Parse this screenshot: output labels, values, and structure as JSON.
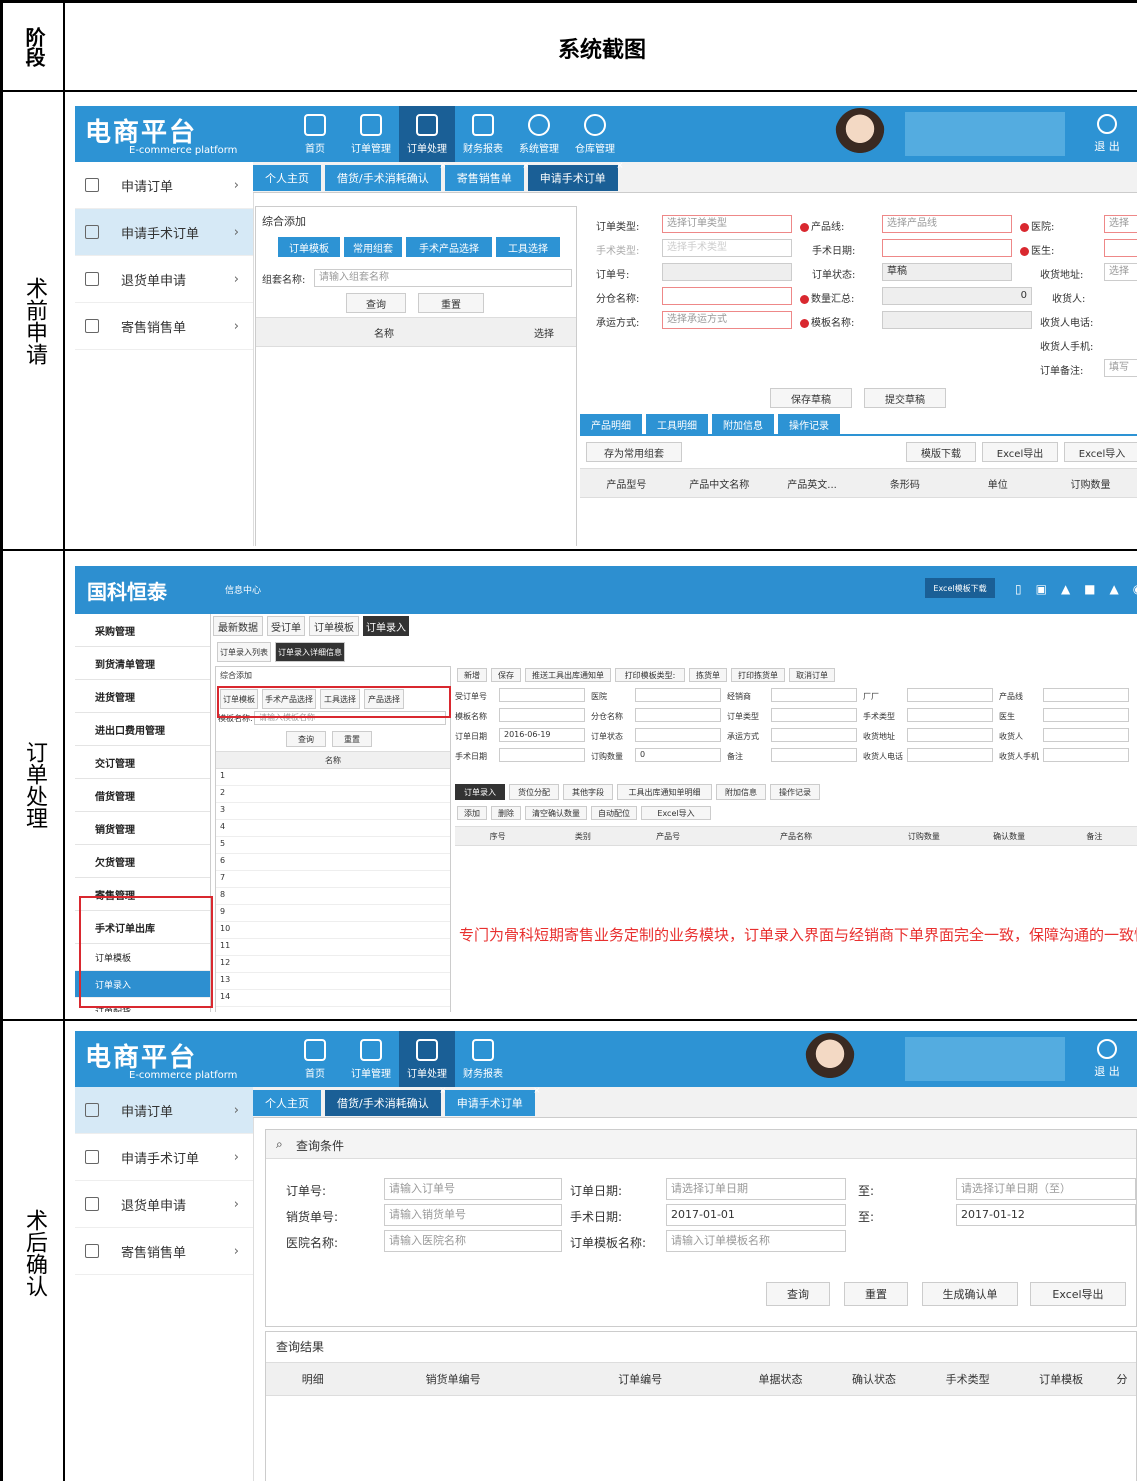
{
  "header": {
    "stage": "阶段",
    "title": "系统截图"
  },
  "rows": [
    {
      "stage": "术前申请"
    },
    {
      "stage": "订单处理"
    },
    {
      "stage": "术后确认"
    }
  ],
  "ec": {
    "logo": "电商平台",
    "logo_sub": "E-commerce platform",
    "nav": [
      "首页",
      "订单管理",
      "订单处理",
      "财务报表",
      "系统管理",
      "仓库管理"
    ],
    "exit": "退 出",
    "side": [
      "申请订单",
      "申请手术订单",
      "退货单申请",
      "寄售销售单"
    ]
  },
  "shot1": {
    "tabs": [
      "个人主页",
      "借货/手术消耗确认",
      "寄售销售单",
      "申请手术订单"
    ],
    "left_title": "综合添加",
    "left_tabs": [
      "订单模板",
      "常用组套",
      "手术产品选择",
      "工具选择"
    ],
    "group_label": "组套名称:",
    "group_placeholder": "请输入组套名称",
    "query": "查询",
    "reset": "重置",
    "col_name": "名称",
    "col_select": "选择",
    "form": {
      "order_type": "订单类型:",
      "order_type_ph": "选择订单类型",
      "product_line": "产品线:",
      "product_line_ph": "选择产品线",
      "hospital": "医院:",
      "hospital_ph": "选择",
      "surgery_type": "手术类型:",
      "surgery_type_ph": "选择手术类型",
      "surgery_date": "手术日期:",
      "doctor": "医生:",
      "order_no": "订单号:",
      "order_status": "订单状态:",
      "order_status_val": "草稿",
      "recv_addr": "收货地址:",
      "recv_addr_ph": "选择",
      "warehouse": "分仓名称:",
      "qty_total": "数量汇总:",
      "qty_total_val": "0",
      "receiver": "收货人:",
      "ship": "承运方式:",
      "ship_ph": "选择承运方式",
      "template": "模板名称:",
      "recv_phone": "收货人电话:",
      "recv_mobile": "收货人手机:",
      "remark": "订单备注:",
      "remark_ph": "填写"
    },
    "save_draft": "保存草稿",
    "submit_draft": "提交草稿",
    "bottom_tabs": [
      "产品明细",
      "工具明细",
      "附加信息",
      "操作记录"
    ],
    "save_common": "存为常用组套",
    "tpl_download": "模版下载",
    "excel_export": "Excel导出",
    "excel_import": "Excel导入",
    "cols": [
      "产品型号",
      "产品中文名称",
      "产品英文...",
      "条形码",
      "单位",
      "订购数量"
    ]
  },
  "shot2": {
    "logo": "国科恒泰",
    "topnav": "信息中心",
    "excel_btn": "Excel模板下载",
    "side": [
      "采购管理",
      "到货清单管理",
      "进货管理",
      "进出口费用管理",
      "交订管理",
      "借货管理",
      "销货管理",
      "欠货管理",
      "寄售管理",
      "手术订单出库"
    ],
    "sub": [
      "订单模板",
      "订单录入",
      "订单配货"
    ],
    "tabs": [
      "最新数据",
      "受订单",
      "订单模板",
      "订单录入"
    ],
    "subtabs": [
      "订单录入列表",
      "订单录入详细信息"
    ],
    "left_title": "综合添加",
    "left_tabs": [
      "订单模板",
      "手术产品选择",
      "工具选择",
      "产品选择"
    ],
    "tpl_label": "模板名称:",
    "tpl_ph": "请输入模板名称",
    "query": "查询",
    "reset": "重置",
    "col_name": "名称",
    "list_rows": [
      "1",
      "2",
      "3",
      "4",
      "5",
      "6",
      "7",
      "8",
      "9",
      "10",
      "11",
      "12",
      "13",
      "14"
    ],
    "toolbar": [
      "新增",
      "保存",
      "推送工具出库通知单",
      "打印模板类型:",
      "拣货单",
      "打印拣货单",
      "取消订单"
    ],
    "form_labels": [
      "受订单号",
      "医院",
      "经销商",
      "厂厂",
      "产品线",
      "模板名称",
      "分仓名称",
      "订单类型",
      "手术类型",
      "医生",
      "订单日期",
      "订单状态",
      "承运方式",
      "收货地址",
      "收货人",
      "手术日期",
      "订购数量",
      "备注",
      "收货人电话",
      "收货人手机"
    ],
    "order_date": "2016-06-19",
    "qty": "0",
    "bottom_tabs": [
      "订单录入",
      "货位分配",
      "其他字段",
      "工具出库通知单明细",
      "附加信息",
      "操作记录"
    ],
    "ops": [
      "添加",
      "删除",
      "清空确认数量",
      "自动配位",
      "Excel导入"
    ],
    "cols": [
      "序号",
      "类别",
      "产品号",
      "产品名称",
      "订购数量",
      "确认数量",
      "备注"
    ],
    "note": "专门为骨科短期寄售业务定制的业务模块，订单录入界面与经销商下单界面完全一致，保障沟通的一致性",
    "note_color": "#e8302f"
  },
  "shot3": {
    "tabs": [
      "个人主页",
      "借货/手术消耗确认",
      "申请手术订单"
    ],
    "query_title": "查询条件",
    "order_no": "订单号:",
    "order_no_ph": "请输入订单号",
    "order_date": "订单日期:",
    "order_date_ph": "请选择订单日期",
    "to": "至:",
    "order_date_to_ph": "请选择订单日期（至）",
    "sale_no": "销货单号:",
    "sale_no_ph": "请输入销货单号",
    "surgery_date": "手术日期:",
    "surgery_from": "2017-01-01",
    "surgery_to": "2017-01-12",
    "hospital": "医院名称:",
    "hospital_ph": "请输入医院名称",
    "tpl": "订单模板名称:",
    "tpl_ph": "请输入订单模板名称",
    "query": "查询",
    "reset": "重置",
    "gen": "生成确认单",
    "excel": "Excel导出",
    "result_title": "查询结果",
    "cols": [
      "明细",
      "销货单编号",
      "订单编号",
      "单据状态",
      "确认状态",
      "手术类型",
      "订单模板",
      "分"
    ]
  }
}
